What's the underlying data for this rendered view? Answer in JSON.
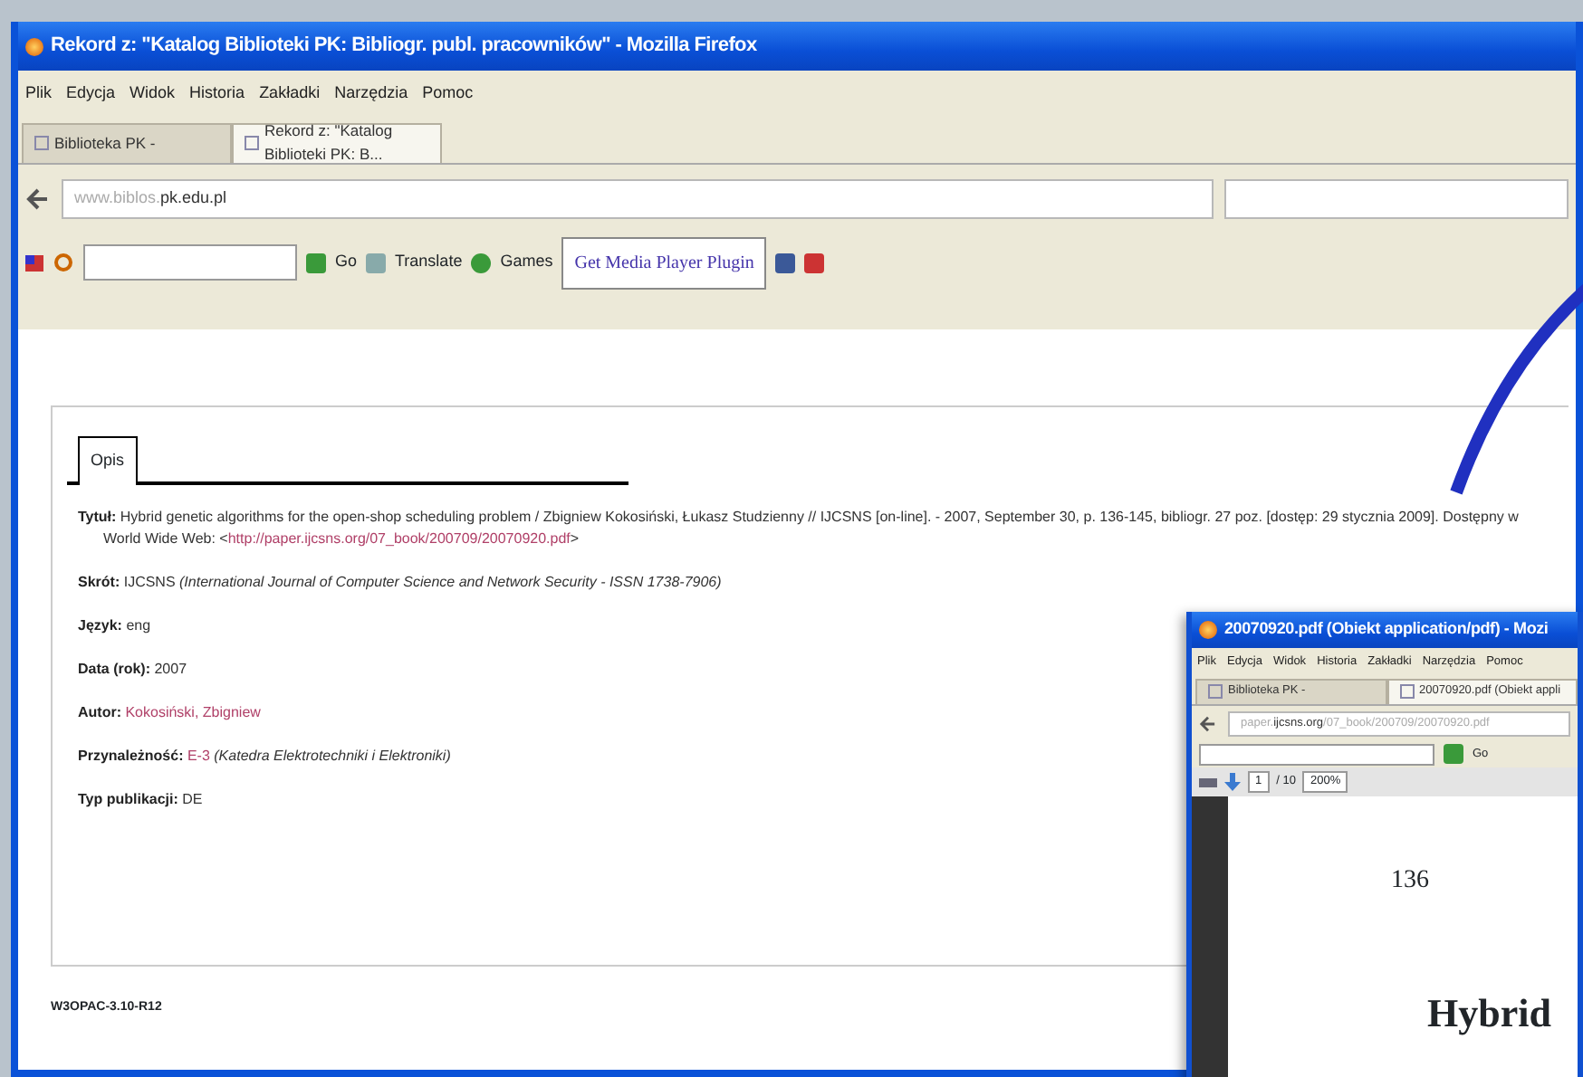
{
  "window": {
    "title": "Rekord z: \"Katalog Biblioteki PK: Bibliogr. publ. pracowników\" - Mozilla Firefox"
  },
  "menu": [
    "Plik",
    "Edycja",
    "Widok",
    "Historia",
    "Zakładki",
    "Narzędzia",
    "Pomoc"
  ],
  "tabs": [
    {
      "label": "Biblioteka PK -",
      "selected": false
    },
    {
      "label": "Rekord z: \"Katalog Biblioteki PK: B...",
      "selected": true
    }
  ],
  "address_bar": {
    "host": "www.biblos.",
    "domain": "pk.edu.pl"
  },
  "toolbar": {
    "go": "Go",
    "translate": "Translate",
    "games": "Games",
    "media": "Get Media Player Plugin"
  },
  "record_tabs": [
    {
      "label": "Opis",
      "selected": true
    }
  ],
  "fields": [
    {
      "label": "Tytuł:",
      "segments": [
        {
          "kind": "plain",
          "text": "Hybrid genetic algorithms for the open-shop scheduling problem / Zbigniew Kokosiński, Łukasz Studzienny // IJCSNS [on-line]. - 2007, September 30, p. 136-145, bibliogr. 27 poz. [dostęp: 29 stycznia 2009]. Dostępny w World Wide Web: <"
        },
        {
          "kind": "link",
          "text": "http://paper.ijcsns.org/07_book/200709/20070920.pdf"
        },
        {
          "kind": "plain",
          "text": ">"
        }
      ]
    },
    {
      "label": "Skrót:",
      "segments": [
        {
          "kind": "plain",
          "text": "IJCSNS "
        },
        {
          "kind": "italic",
          "text": "(International Journal of Computer Science and Network Security - ISSN 1738-7906)"
        }
      ]
    },
    {
      "label": "Język:",
      "segments": [
        {
          "kind": "plain",
          "text": "eng"
        }
      ]
    },
    {
      "label": "Data (rok):",
      "segments": [
        {
          "kind": "plain",
          "text": "2007"
        }
      ]
    },
    {
      "label": "Autor:",
      "segments": [
        {
          "kind": "link",
          "text": "Kokosiński, Zbigniew"
        }
      ]
    },
    {
      "label": "Przynależność:",
      "segments": [
        {
          "kind": "link",
          "text": "E-3"
        },
        {
          "kind": "italic",
          "text": " (Katedra Elektrotechniki i Elektroniki)"
        }
      ]
    },
    {
      "label": "Typ publikacji:",
      "segments": [
        {
          "kind": "plain",
          "text": "DE"
        }
      ]
    }
  ],
  "footer": "W3OPAC-3.10-R12",
  "pdf_window": {
    "title": "20070920.pdf (Obiekt application/pdf) - Mozi",
    "menu": [
      "Plik",
      "Edycja",
      "Widok",
      "Historia",
      "Zakładki",
      "Narzędzia",
      "Pomoc"
    ],
    "tabs": [
      {
        "label": "Biblioteka PK -",
        "selected": false
      },
      {
        "label": "20070920.pdf (Obiekt appli",
        "selected": true
      }
    ],
    "url_host": "paper.",
    "url_domain": "ijcsns.org",
    "url_path": "/07_book/200709/20070920.pdf",
    "go": "Go",
    "page": "1",
    "page_count": "/ 10",
    "zoom": "200%",
    "page_number": "136",
    "heading": "Hybrid"
  }
}
